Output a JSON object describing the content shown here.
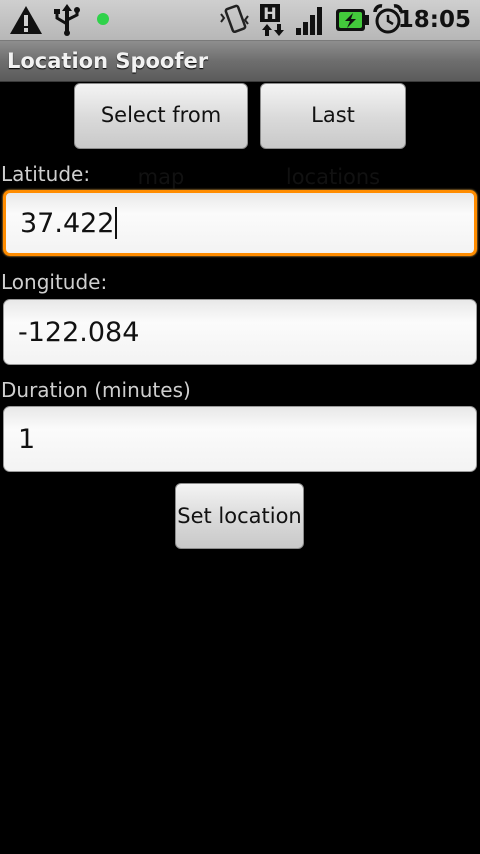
{
  "status_bar": {
    "time": "18:05",
    "icons": [
      "warning-icon",
      "usb-icon",
      "notification-led-icon",
      "vibrate-icon",
      "hspa-data-icon",
      "signal-icon",
      "battery-charging-icon",
      "alarm-icon"
    ],
    "led_color": "#2fd24a"
  },
  "app_bar": {
    "title": "Location Spoofer"
  },
  "top_buttons": {
    "select_from_map": "Select from map",
    "last_locations": "Last locations"
  },
  "form": {
    "latitude": {
      "label": "Latitude:",
      "value": "37.422"
    },
    "longitude": {
      "label": "Longitude:",
      "value": "-122.084"
    },
    "duration": {
      "label": "Duration (minutes)",
      "value": "1"
    }
  },
  "actions": {
    "set_location": "Set location"
  },
  "colors": {
    "focus": "#ff8c00"
  }
}
